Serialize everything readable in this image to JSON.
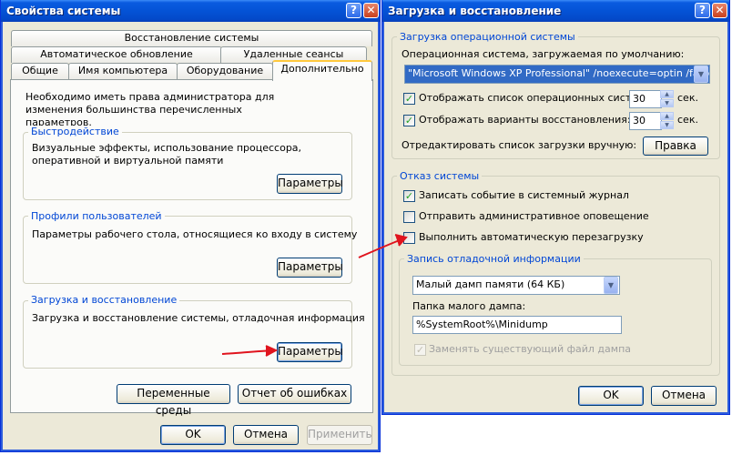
{
  "colors": {
    "title_blue": "#0453d6",
    "accent_group": "#0046d5",
    "window_bg": "#ece9d8",
    "arrow_red": "#e0141e"
  },
  "sysprops": {
    "title": "Свойства системы",
    "tabs_row1": [
      "Восстановление системы"
    ],
    "tabs_row2": [
      "Автоматическое обновление",
      "Удаленные сеансы"
    ],
    "tabs_row3": [
      "Общие",
      "Имя компьютера",
      "Оборудование",
      "Дополнительно"
    ],
    "admin_note": "Необходимо иметь права администратора для изменения большинства перечисленных параметров.",
    "perf": {
      "title": "Быстродействие",
      "desc": "Визуальные эффекты, использование процессора, оперативной и виртуальной памяти",
      "button": "Параметры"
    },
    "profiles": {
      "title": "Профили пользователей",
      "desc": "Параметры рабочего стола, относящиеся ко входу в систему",
      "button": "Параметры"
    },
    "startup": {
      "title": "Загрузка и восстановление",
      "desc": "Загрузка и восстановление системы, отладочная информация",
      "button": "Параметры"
    },
    "env_button": "Переменные среды",
    "errors_button": "Отчет об ошибках",
    "ok": "OK",
    "cancel": "Отмена",
    "apply": "Применить"
  },
  "startup_dialog": {
    "title": "Загрузка и восстановление",
    "os_group": {
      "title": "Загрузка операционной системы",
      "default_label": "Операционная система, загружаемая по умолчанию:",
      "default_value": "\"Microsoft Windows XP Professional\" /noexecute=optin /fastdete",
      "show_list_label": "Отображать список операционных систем:",
      "show_list_value": "30",
      "show_recovery_label": "Отображать варианты восстановления:",
      "show_recovery_value": "30",
      "sec": "сек.",
      "edit_label": "Отредактировать список загрузки вручную:",
      "edit_button": "Правка"
    },
    "failure_group": {
      "title": "Отказ системы",
      "write_event": "Записать событие в системный журнал",
      "send_alert": "Отправить административное оповещение",
      "auto_restart": "Выполнить автоматическую перезагрузку"
    },
    "debug_group": {
      "title": "Запись отладочной информации",
      "dump_type": "Малый дамп памяти (64 КБ)",
      "folder_label": "Папка малого дампа:",
      "folder_value": "%SystemRoot%\\Minidump",
      "overwrite": "Заменять существующий файл дампа"
    },
    "ok": "OK",
    "cancel": "Отмена"
  },
  "icons": {
    "help": "?",
    "close": "✕",
    "check": "✓",
    "dropdown": "▼",
    "spin_up": "▲",
    "spin_down": "▼"
  }
}
